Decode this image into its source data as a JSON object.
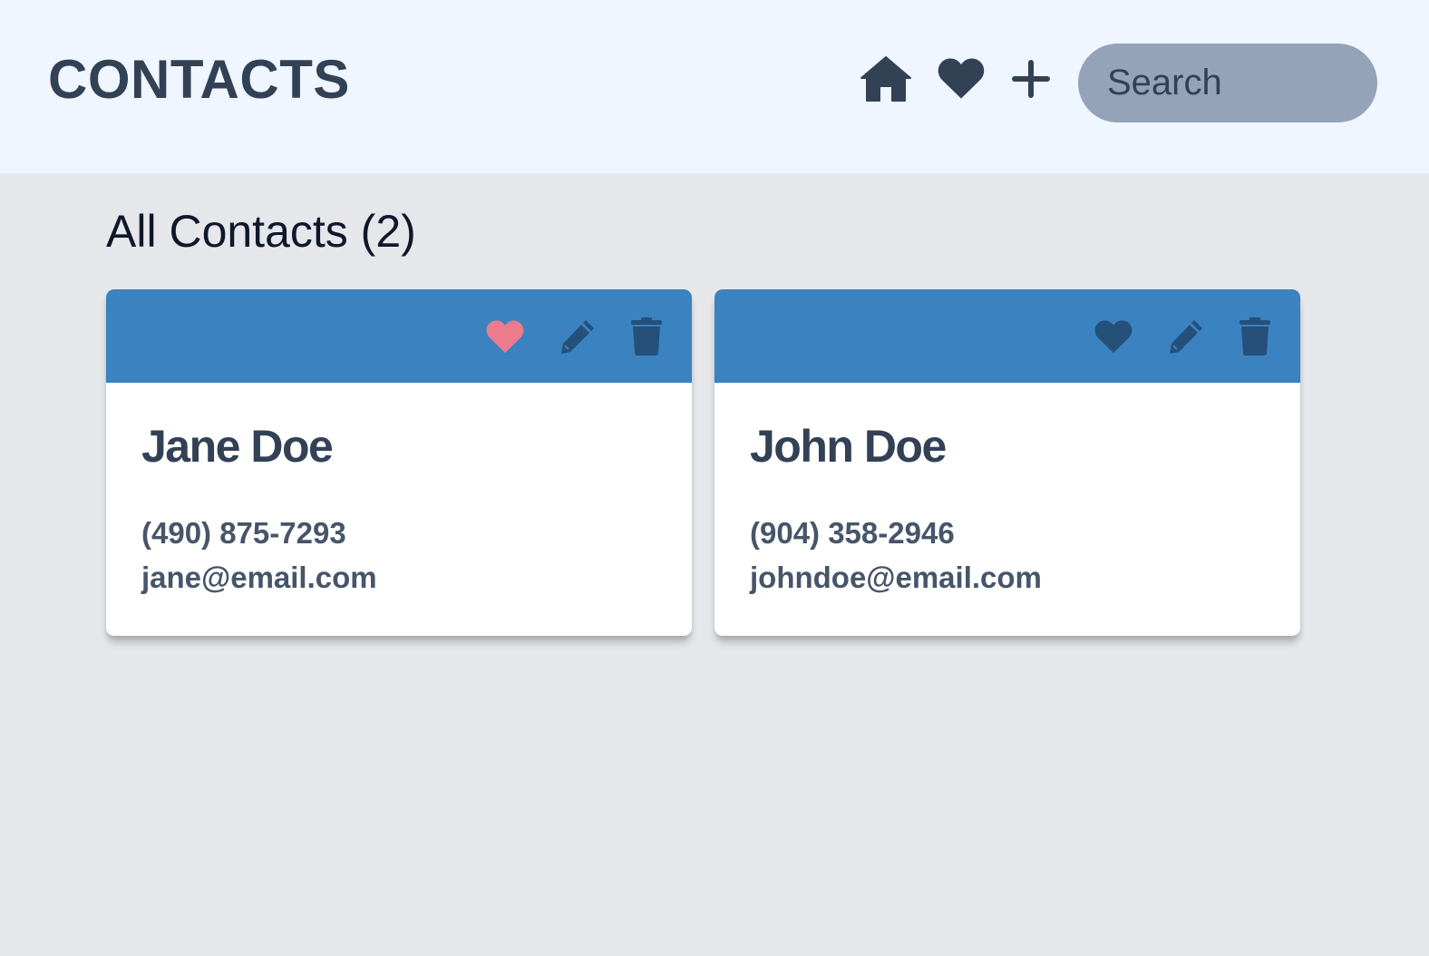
{
  "header": {
    "title": "CONTACTS",
    "nav": {
      "home_icon": "home-icon",
      "favorites_icon": "heart-icon",
      "add_icon": "plus-icon"
    },
    "search": {
      "placeholder": "Search",
      "value": ""
    }
  },
  "main": {
    "heading": "All Contacts (2)",
    "contacts": [
      {
        "name": "Jane Doe",
        "phone": "(490) 875-7293",
        "email": "jane@email.com",
        "favorite": true
      },
      {
        "name": "John Doe",
        "phone": "(904) 358-2946",
        "email": "johndoe@email.com",
        "favorite": false
      }
    ]
  },
  "colors": {
    "header_bg": "#eff6ff",
    "page_bg": "#e5e7eb",
    "card_header": "#3b82c0",
    "favorite_active": "#ec7b8b",
    "action_icon": "#24507a",
    "search_bg": "#94a3b8",
    "text_dark": "#334155"
  }
}
